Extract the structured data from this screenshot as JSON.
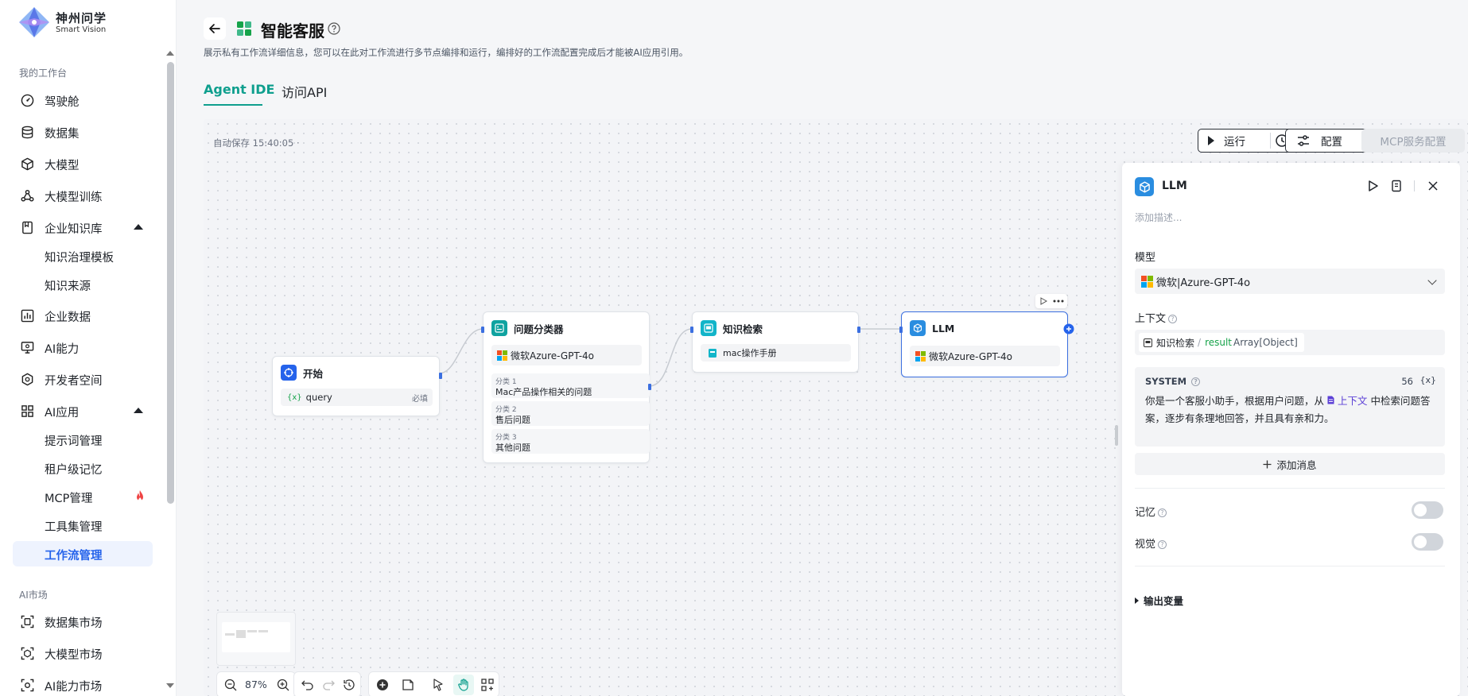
{
  "brand": {
    "name_cn": "神州问学",
    "name_en": "Smart Vision"
  },
  "sidebar": {
    "group_workbench": "我的工作台",
    "items": [
      {
        "label": "驾驶舱"
      },
      {
        "label": "数据集"
      },
      {
        "label": "大模型"
      },
      {
        "label": "大模型训练"
      },
      {
        "label": "企业知识库"
      },
      {
        "label": "知识治理模板"
      },
      {
        "label": "知识来源"
      },
      {
        "label": "企业数据"
      },
      {
        "label": "AI能力"
      },
      {
        "label": "开发者空间"
      },
      {
        "label": "AI应用"
      },
      {
        "label": "提示词管理"
      },
      {
        "label": "租户级记忆"
      },
      {
        "label": "MCP管理"
      },
      {
        "label": "工具集管理"
      },
      {
        "label": "工作流管理"
      }
    ],
    "group_market": "AI市场",
    "market_items": [
      {
        "label": "数据集市场"
      },
      {
        "label": "大模型市场"
      },
      {
        "label": "AI能力市场"
      }
    ]
  },
  "header": {
    "title": "智能客服",
    "description": "展示私有工作流详细信息，您可以在此对工作流进行多节点编排和运行，编排好的工作流配置完成后才能被AI应用引用。",
    "tabs": [
      {
        "label": "Agent IDE"
      },
      {
        "label": "访问API"
      }
    ]
  },
  "canvas": {
    "autosave": "自动保存 15:40:05 ·",
    "run_label": "运行",
    "config_label": "配置",
    "mcp_label": "MCP服务配置",
    "zoom": "87%"
  },
  "nodes": {
    "start": {
      "title": "开始",
      "var": "query",
      "required": "必填"
    },
    "classifier": {
      "title": "问题分类器",
      "model": "微软Azure-GPT-4o",
      "categories": [
        {
          "label": "分类 1",
          "text": "Mac产品操作相关的问题"
        },
        {
          "label": "分类 2",
          "text": "售后问题"
        },
        {
          "label": "分类 3",
          "text": "其他问题"
        }
      ]
    },
    "retrieval": {
      "title": "知识检索",
      "kb": "mac操作手册"
    },
    "llm": {
      "title": "LLM",
      "model": "微软Azure-GPT-4o"
    }
  },
  "panel": {
    "title": "LLM",
    "desc_placeholder": "添加描述...",
    "model_label": "模型",
    "model_value": "微软|Azure-GPT-4o",
    "context_label": "上下文",
    "context_source": "知识检索",
    "context_sep": "/",
    "context_var": "result",
    "context_type": "Array[Object]",
    "system_title": "SYSTEM",
    "system_count": "56",
    "system_var_btn": "{x}",
    "system_text_before": "你是一个客服小助手，根据用户问题，从",
    "system_ref": "上下文",
    "system_text_after": "中检索问题答案，逐步有条理地回答，并且具有亲和力。",
    "add_message": "添加消息",
    "memory_label": "记忆",
    "vision_label": "视觉",
    "output_vars": "输出变量"
  },
  "colors": {
    "accent": "#0f9f8e",
    "active_nav": "#2563eb",
    "port": "#3b6fe0",
    "llm_icon": "#2a8de0"
  }
}
